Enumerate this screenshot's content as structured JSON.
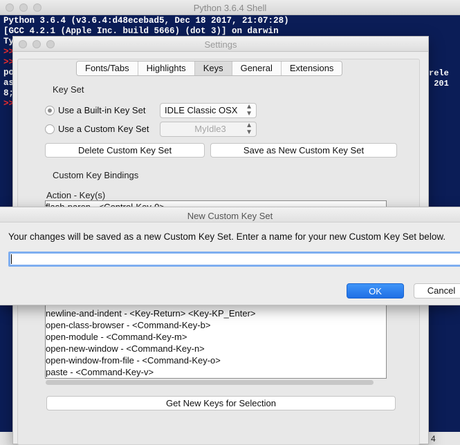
{
  "shell": {
    "title": "Python 3.6.4 Shell",
    "lines": [
      "Python 3.6.4 (v3.6.4:d48ecebad5, Dec 18 2017, 21:07:28)",
      "[GCC 4.2.1 (Apple Inc. build 5666) (dot 3)] on darwin",
      "Ty",
      "",
      "",
      "po",
      "as",
      "8;",
      ""
    ],
    "prompt": ">>",
    "right_fragments": [
      "rele",
      " 201"
    ],
    "status_col": "4"
  },
  "settings": {
    "title": "Settings",
    "tabs": [
      {
        "label": "Fonts/Tabs",
        "active": false
      },
      {
        "label": "Highlights",
        "active": false
      },
      {
        "label": "Keys",
        "active": true
      },
      {
        "label": "General",
        "active": false
      },
      {
        "label": "Extensions",
        "active": false
      }
    ],
    "key_set_label": "Key Set",
    "builtin_radio_label": "Use a Built-in Key Set",
    "builtin_value": "IDLE Classic OSX",
    "custom_radio_label": "Use a Custom Key Set",
    "custom_value": "MyIdle3",
    "delete_button": "Delete Custom Key Set",
    "save_as_button": "Save as New Custom Key Set",
    "bindings_label": "Custom Key Bindings",
    "action_header": "Action - Key(s)",
    "bindings": [
      "flash-paren - <Control-Key-0>",
      "newline-and-indent - <Key-Return> <Key-KP_Enter>",
      "open-class-browser - <Command-Key-b>",
      "open-module - <Command-Key-m>",
      "open-new-window - <Command-Key-n>",
      "open-window-from-file - <Command-Key-o>",
      "paste - <Command-Key-v>"
    ],
    "get_new_keys_button": "Get New Keys for Selection"
  },
  "dialog": {
    "title": "New Custom Key Set",
    "message": "Your changes will be saved as a new Custom Key Set. Enter a name for your new Custom Key Set below.",
    "input_value": "",
    "ok_label": "OK",
    "cancel_label": "Cancel"
  }
}
